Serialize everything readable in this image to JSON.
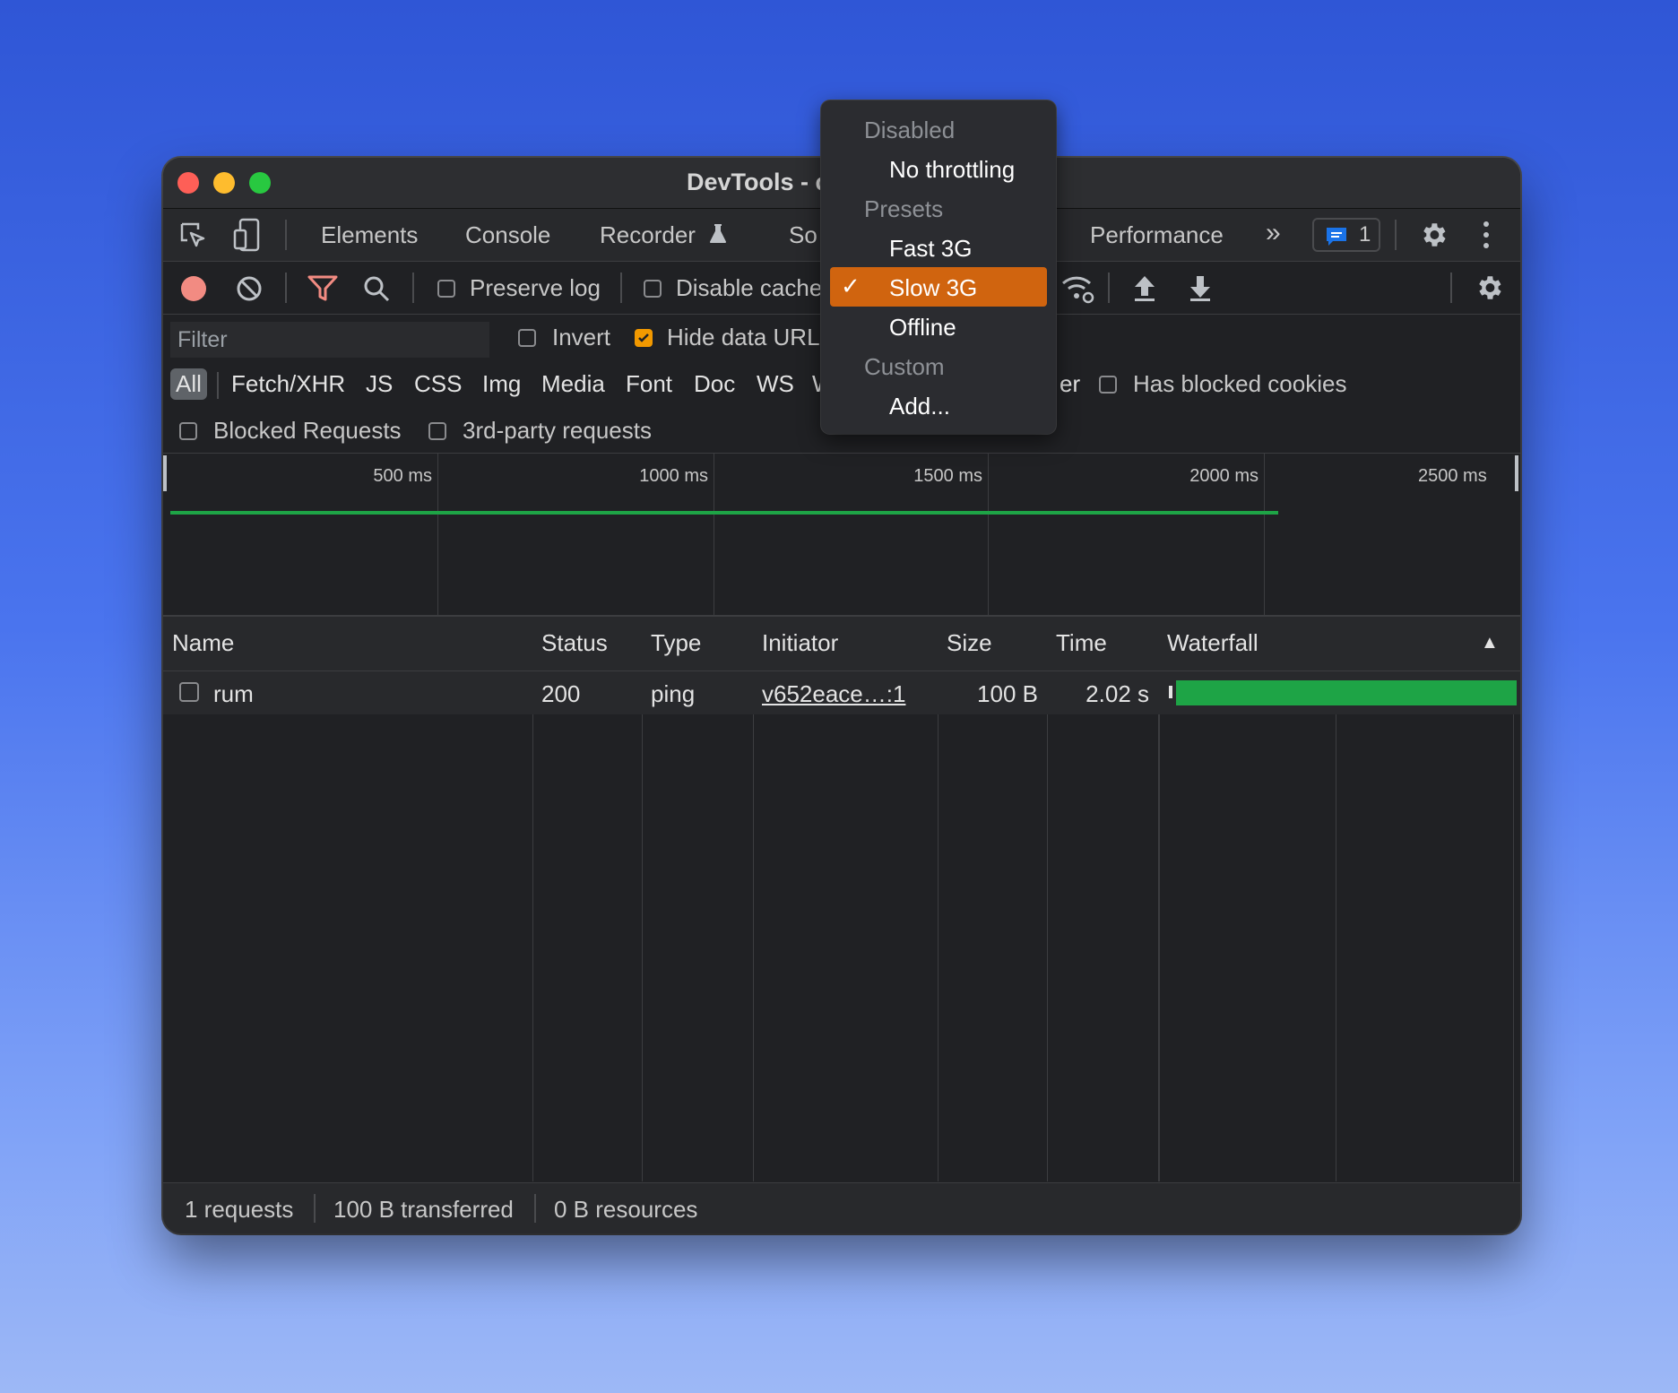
{
  "window": {
    "title": "DevTools - c"
  },
  "tabs": {
    "items": [
      "Elements",
      "Console",
      "Recorder",
      "So",
      "Performance"
    ],
    "more_label": "»",
    "messages_count": "1"
  },
  "toolbar": {
    "preserve_log": "Preserve log",
    "disable_cache": "Disable cache"
  },
  "filter": {
    "placeholder": "Filter",
    "invert": "Invert",
    "hide_data_urls": "Hide data URL",
    "types": [
      "All",
      "Fetch/XHR",
      "JS",
      "CSS",
      "Img",
      "Media",
      "Font",
      "Doc",
      "WS",
      "W"
    ],
    "partial_label": "er",
    "has_blocked_cookies": "Has blocked cookies",
    "blocked_requests": "Blocked Requests",
    "third_party": "3rd-party requests"
  },
  "overview": {
    "ticks": [
      "500 ms",
      "1000 ms",
      "1500 ms",
      "2000 ms",
      "2500 ms"
    ]
  },
  "table": {
    "columns": [
      "Name",
      "Status",
      "Type",
      "Initiator",
      "Size",
      "Time",
      "Waterfall"
    ],
    "sort_indicator": "▲",
    "rows": [
      {
        "name": "rum",
        "status": "200",
        "type": "ping",
        "initiator": "v652eace…:1",
        "size": "100 B",
        "time": "2.02 s"
      }
    ]
  },
  "status": {
    "requests": "1 requests",
    "transferred": "100 B transferred",
    "resources": "0 B resources"
  },
  "throttle_menu": {
    "sections": [
      {
        "header": "Disabled",
        "items": [
          "No throttling"
        ]
      },
      {
        "header": "Presets",
        "items": [
          "Fast 3G",
          "Slow 3G",
          "Offline"
        ]
      },
      {
        "header": "Custom",
        "items": [
          "Add..."
        ]
      }
    ],
    "selected": "Slow 3G",
    "check_mark": "✓"
  },
  "colors": {
    "accent_orange": "#d0640f",
    "record_red": "#f28b82",
    "waterfall_green": "#1ea446",
    "checkbox_orange": "#f29900"
  }
}
